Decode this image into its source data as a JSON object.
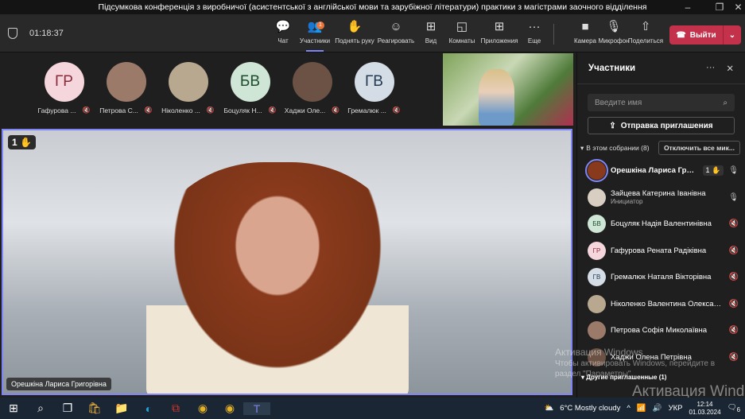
{
  "window": {
    "title": "Підсумкова конференція з виробничої (асистентської з англійської мови та зарубіжної літератури) практики з магістрами заочного відділення",
    "minimize": "–",
    "maximize": "❐",
    "close": "✕"
  },
  "toolbar": {
    "timer": "01:18:37",
    "participants_badge": "1",
    "buttons": [
      {
        "label": "Чат",
        "icon": "💬"
      },
      {
        "label": "Участники",
        "icon": "👥"
      },
      {
        "label": "Поднять руку",
        "icon": "✋"
      },
      {
        "label": "Реагировать",
        "icon": "☺"
      },
      {
        "label": "Вид",
        "icon": "⊞"
      },
      {
        "label": "Комнаты",
        "icon": "◱"
      },
      {
        "label": "Приложения",
        "icon": "⊞"
      },
      {
        "label": "Еще",
        "icon": "···"
      },
      {
        "label": "Камера",
        "icon": "■"
      },
      {
        "label": "Микрофон",
        "icon": "🎙"
      },
      {
        "label": "Поделиться",
        "icon": "⇧"
      }
    ],
    "leave": "Выйти"
  },
  "gallery": [
    {
      "initials": "ГР",
      "name": "Гафурова ...",
      "bg": "#f4d6dc",
      "fg": "#8a2a3a"
    },
    {
      "initials": "",
      "name": "Петрова С...",
      "bg": "#9b7a6a",
      "fg": "#fff"
    },
    {
      "initials": "",
      "name": "Ніколенко ...",
      "bg": "#b8a890",
      "fg": "#fff"
    },
    {
      "initials": "БВ",
      "name": "Боцуляк Н...",
      "bg": "#cfe6d6",
      "fg": "#1e4d2e"
    },
    {
      "initials": "",
      "name": "Хаджи Оле...",
      "bg": "#6b5245",
      "fg": "#fff"
    },
    {
      "initials": "ГВ",
      "name": "Гремалюк ...",
      "bg": "#d4dde6",
      "fg": "#233a52"
    }
  ],
  "stage": {
    "hand_count": "1",
    "speaker": "Орешкіна Лариса Григорівна"
  },
  "panel": {
    "title": "Участники",
    "search_placeholder": "Введите имя",
    "invite": "Отправка приглашения",
    "section": "В этом собрании (8)",
    "mute_all": "Отключить все мик...",
    "other_section": "Другие приглашенные (1)",
    "participants": [
      {
        "name": "Орешкіна Лариса Григ...",
        "initials": "",
        "bg": "#8a3a1c",
        "hand": "1",
        "mic": "🎙"
      },
      {
        "name": "Зайцева Катерина Іванівна",
        "role": "Инициатор",
        "initials": "",
        "bg": "#d8cfc2",
        "mic": "🎙"
      },
      {
        "name": "Боцуляк Надія Валентинівна",
        "initials": "БВ",
        "bg": "#cfe6d6",
        "fg": "#1e4d2e",
        "mic": "🔇"
      },
      {
        "name": "Гафурова Рената Радіківна",
        "initials": "ГР",
        "bg": "#f4d6dc",
        "fg": "#8a2a3a",
        "mic": "🔇"
      },
      {
        "name": "Гремалюк Наталя Вікторівна",
        "initials": "ГВ",
        "bg": "#d4dde6",
        "fg": "#233a52",
        "mic": "🔇"
      },
      {
        "name": "Ніколенко Валентина Олександ...",
        "initials": "",
        "bg": "#b8a890",
        "mic": "🔇"
      },
      {
        "name": "Петрова Софія Миколаївна",
        "initials": "",
        "bg": "#9b7a6a",
        "mic": "🔇"
      },
      {
        "name": "Хаджи Олена Петрівна",
        "initials": "",
        "bg": "#6b5245",
        "mic": "🔇"
      }
    ]
  },
  "watermark": {
    "line1": "Активация Windows",
    "line2": "Чтобы активировать Windows, перейдите в",
    "line3": "раздел \"Параметры\".",
    "big": "Активация Windows"
  },
  "taskbar": {
    "weather": "6°C  Mostly cloudy",
    "lang": "УКР",
    "time": "12:14",
    "date": "01.03.2024",
    "notif": "6"
  }
}
